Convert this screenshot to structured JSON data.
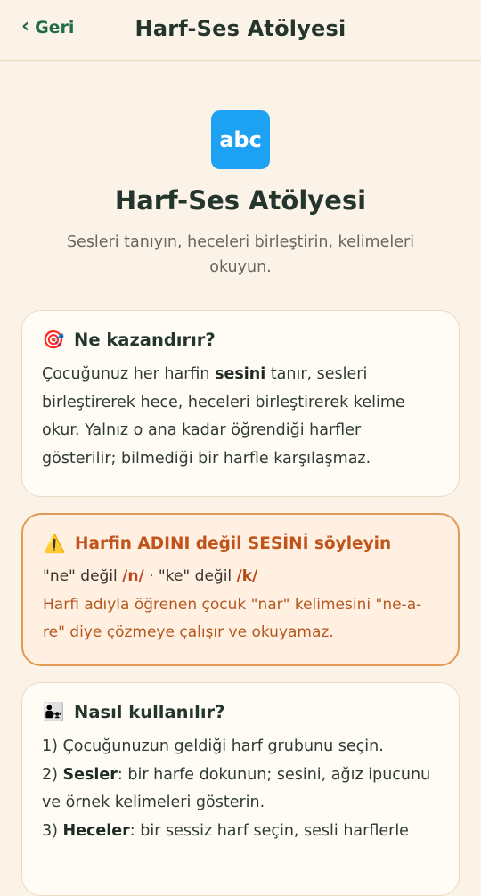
{
  "header": {
    "back_label": "Geri",
    "title": "Harf-Ses Atölyesi"
  },
  "hero": {
    "icon_text": "abc",
    "title": "Harf-Ses Atölyesi",
    "subtitle": "Sesleri tanıyın, heceleri birleştirin, kelimeleri okuyun."
  },
  "card_benefit": {
    "icon": "🎯",
    "title": "Ne kazandırır?",
    "text_1": "Çocuğunuz her harfin ",
    "text_bold": "sesini",
    "text_2": " tanır, sesleri birleştirerek hece, heceleri birleştirerek kelime okur. Yalnız o ana kadar öğrendiği harfler gösterilir; bilmediği bir harfle karşılaşmaz."
  },
  "card_warning": {
    "icon": "⚠️",
    "title": "Harfin ADINI değil SESİNİ söyleyin",
    "l1_a": "\"ne\" değil ",
    "l1_b": "/n/",
    "l1_c": " · \"ke\" değil ",
    "l1_d": "/k/",
    "l2": "Harfi adıyla öğrenen çocuk \"nar\" kelimesini \"ne-a-re\" diye çözmeye çalışır ve okuyamaz."
  },
  "card_howto": {
    "icon": "👨‍👧",
    "title": "Nasıl kullanılır?",
    "step1": "1) Çocuğunuzun geldiği harf grubunu seçin.",
    "step2_num": "2) ",
    "step2_bold": "Sesler",
    "step2_text": ": bir harfe dokunun; sesini, ağız ipucunu ve örnek kelimeleri gösterin.",
    "step3_num": "3) ",
    "step3_bold": "Heceler",
    "step3_text": ": bir sessiz harf seçin, sesli harflerle"
  }
}
